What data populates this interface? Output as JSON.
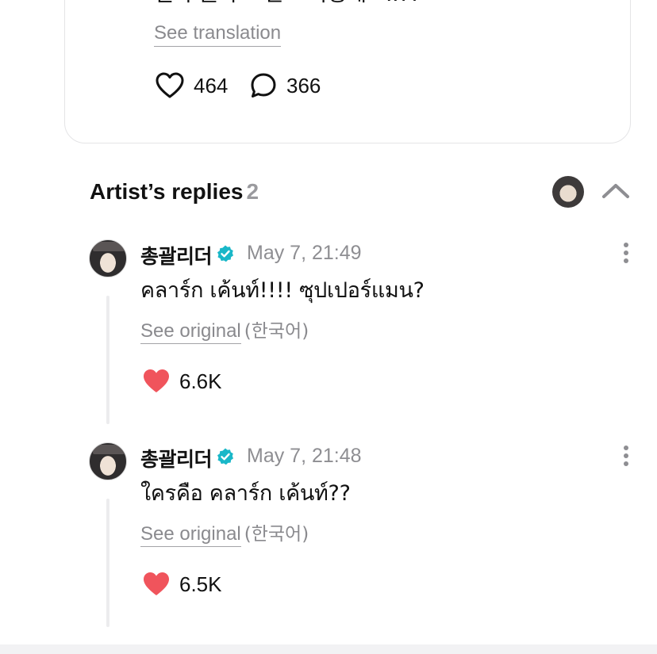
{
  "post": {
    "text": "설마 클라크 켄트 가능해요..??",
    "translate_label": "See translation",
    "likes": "464",
    "comments": "366"
  },
  "artist_replies": {
    "title": "Artist’s replies",
    "count": "2"
  },
  "replies": [
    {
      "author": "총괄리더",
      "time": "May 7, 21:49",
      "text": "คลาร์ก เค้นท์!!!! ซุปเปอร์แมน?",
      "see_original": "See original",
      "original_lang": "(한국어)",
      "likes": "6.6K"
    },
    {
      "author": "총괄리더",
      "time": "May 7, 21:48",
      "text": "ใครคือ คลาร์ก เค้นท์??",
      "see_original": "See original",
      "original_lang": "(한국어)",
      "likes": "6.5K"
    }
  ],
  "colors": {
    "verified": "#19b7c8",
    "heart_filled": "#f0545c",
    "muted_text": "#8e8e92",
    "card_border": "#e4e4e6"
  },
  "icons": {
    "like": "heart-outline-icon",
    "comment": "speech-bubble-icon",
    "verified": "verified-badge-icon",
    "collapse": "chevron-up-icon",
    "more": "more-vertical-icon",
    "liked": "heart-filled-icon"
  }
}
